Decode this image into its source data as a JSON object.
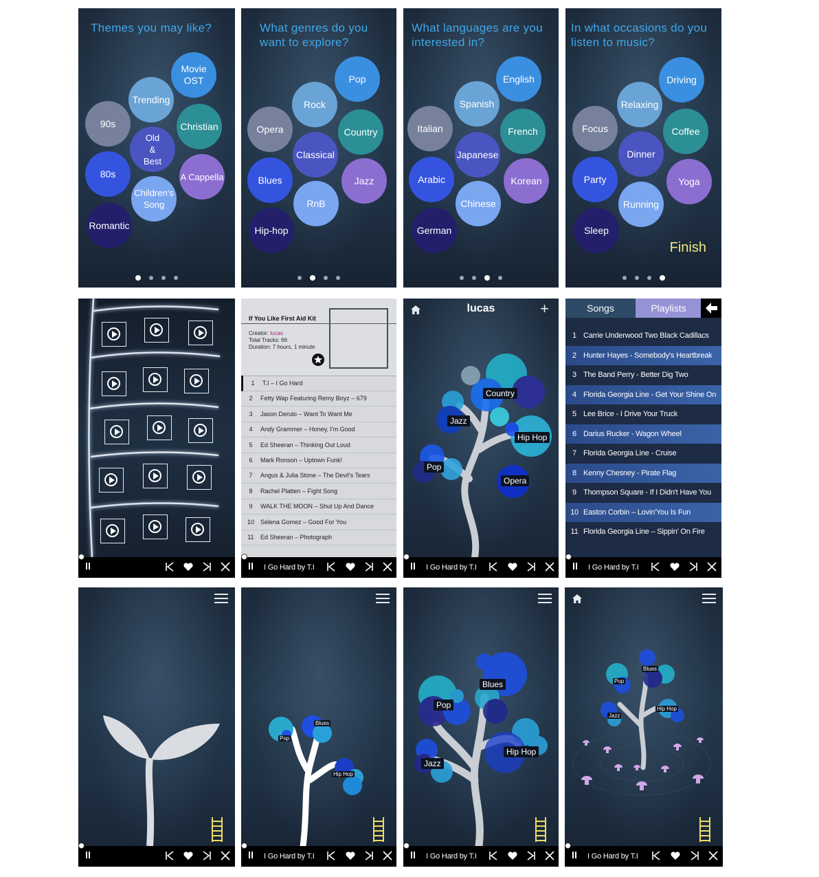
{
  "onboarding": [
    {
      "title": "Themes you may like?",
      "active_dot": 0,
      "options": [
        "Movie OST",
        "Trending",
        "Christian",
        "90s",
        "Old & Best",
        "80s",
        "A Cappella",
        "Children's Song",
        "Romantic"
      ]
    },
    {
      "title": "What genres do you want to explore?",
      "active_dot": 1,
      "options": [
        "Pop",
        "Rock",
        "Opera",
        "Country",
        "Classical",
        "Blues",
        "Jazz",
        "RnB",
        "Hip-hop"
      ]
    },
    {
      "title": "What languages are you interested in?",
      "active_dot": 2,
      "options": [
        "English",
        "Spanish",
        "Italian",
        "French",
        "Japanese",
        "Arabic",
        "Korean",
        "Chinese",
        "German"
      ]
    },
    {
      "title": "In what occasions do you listen to music?",
      "active_dot": 3,
      "options": [
        "Driving",
        "Relaxing",
        "Focus",
        "Coffee",
        "Dinner",
        "Party",
        "Yoga",
        "Running",
        "Sleep"
      ],
      "finish_label": "Finish"
    }
  ],
  "player": {
    "song": "I Go Hard by T.I"
  },
  "playlist_detail": {
    "title": "If You Like First Aid Kit",
    "creator_label": "Creator:",
    "creator": "lucas",
    "total_tracks": "Total Tracks: 66",
    "duration": "Duration: 7 hours, 1 minute",
    "tracks": [
      "T.I – I Go Hard",
      "Fetty Wap Featuring Remy Boyz – 679",
      "Jason Derulo – Want To Want Me",
      "Andy Grammer – Honey, I'm Good",
      "Ed Sheeran – Thinking Out Loud",
      "Mark Ronson – Uptown Funk!",
      "Angus & Julia Stone – The Devil's Tears",
      "Rachel Platten – Fight Song",
      "WALK THE MOON – Shut Up And Dance",
      "Selena Gomez  – Good For You",
      "Ed Sheeran – Photograph"
    ]
  },
  "profile_tree": {
    "user": "lucas",
    "add_label": "+",
    "genres": [
      "Country",
      "Jazz",
      "Hip Hop",
      "Pop",
      "Opera"
    ]
  },
  "songs_list": {
    "tab_songs": "Songs",
    "tab_playlists": "Playlists",
    "songs": [
      "Carrie Underwood Two Black Cadillacs",
      "Hunter Hayes - Somebody's Heartbreak",
      "The Band Perry - Better Dig Two",
      "Florida Georgia Line - Get Your Shine On",
      "Lee Brice - I Drive Your Truck",
      "Darius Rucker - Wagon Wheel",
      "Florida Georgia Line - Cruise",
      "Kenny Chesney - Pirate Flag",
      "Thompson Square - If I Didn't Have You",
      "Easton Corbin – Lovin'You Is Fun",
      "Florida Georgia Line – Sippin' On Fire"
    ]
  },
  "growth": {
    "stage2": [
      "Pop",
      "Blues",
      "Hip Hop"
    ],
    "stage3": [
      "Blues",
      "Pop",
      "Hip Hop",
      "Jazz"
    ],
    "stage4": [
      "Blues",
      "Pop",
      "Hip Hop",
      "Jazz"
    ]
  }
}
